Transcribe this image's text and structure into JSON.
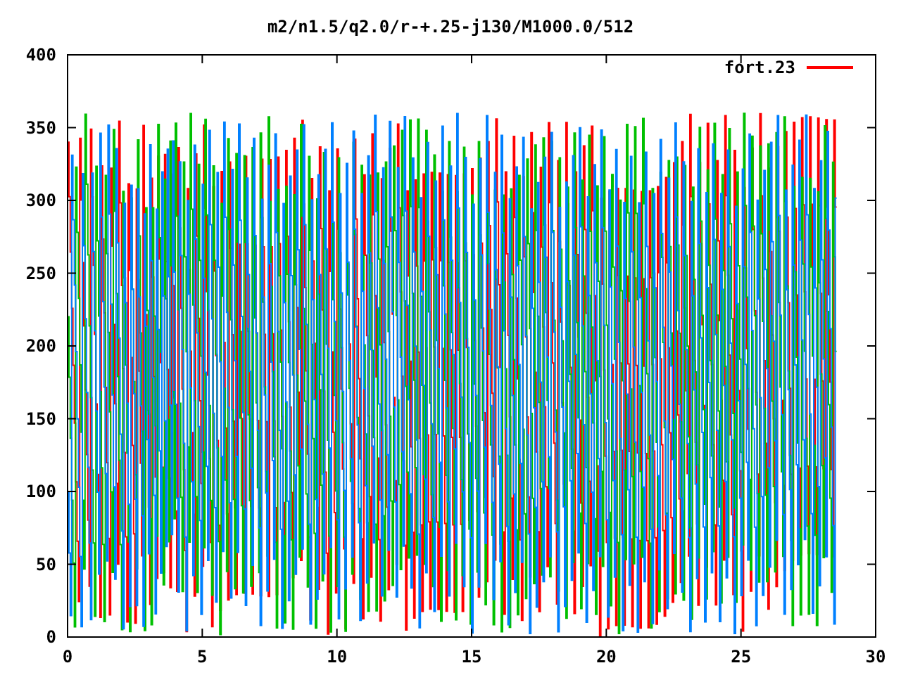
{
  "plot": {
    "title": "m2/n1.5/q2.0/r-+.25-j130/M1000.0/512",
    "legend": [
      {
        "label": "fort.23",
        "color": "#ff0000"
      }
    ],
    "y_ticks": [
      "400",
      "350",
      "300",
      "250",
      "200",
      "150",
      "100",
      "50",
      "0"
    ],
    "x_ticks": [
      "0",
      "5",
      "10",
      "15",
      "20",
      "25",
      "30"
    ]
  }
}
